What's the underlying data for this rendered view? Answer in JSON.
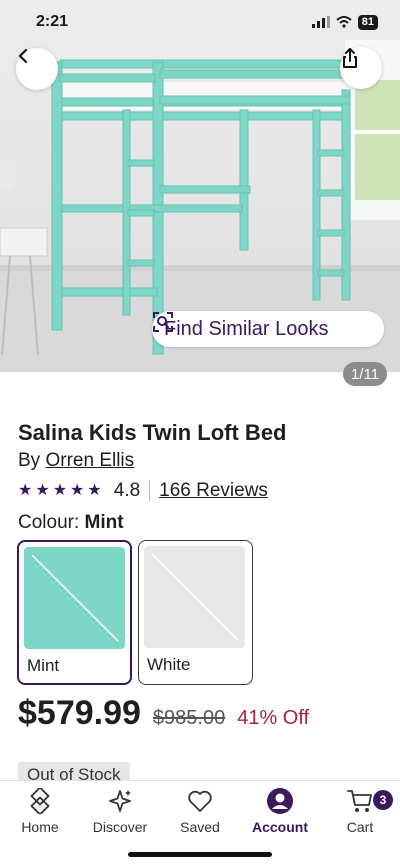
{
  "status": {
    "time": "2:21",
    "battery": "81"
  },
  "gallery": {
    "find_similar_label": "Find Similar Looks",
    "counter": "1/11"
  },
  "product": {
    "title": "Salina Kids Twin Loft Bed",
    "brand_prefix": "By",
    "brand": "Orren Ellis",
    "rating_stars": 5,
    "rating": "4.8",
    "reviews": "166 Reviews",
    "colour_label": "Colour:",
    "colour_selected": "Mint",
    "swatches": [
      {
        "label": "Mint",
        "color": "#7ed6c6",
        "selected": true
      },
      {
        "label": "White",
        "color": "#e8e8e8",
        "selected": false
      }
    ],
    "price": "$579.99",
    "was_price": "$985.00",
    "discount": "41% Off",
    "stock_status": "Out of Stock"
  },
  "nav": {
    "items": [
      {
        "label": "Home",
        "icon": "home-icon"
      },
      {
        "label": "Discover",
        "icon": "sparkle-icon"
      },
      {
        "label": "Saved",
        "icon": "heart-icon"
      },
      {
        "label": "Account",
        "icon": "account-icon",
        "active": true
      },
      {
        "label": "Cart",
        "icon": "cart-icon"
      }
    ],
    "cart_count": "3"
  },
  "colors": {
    "brand_purple": "#3a1a5c",
    "discount_red": "#a4243b",
    "bed_mint": "#7ed6c6"
  }
}
